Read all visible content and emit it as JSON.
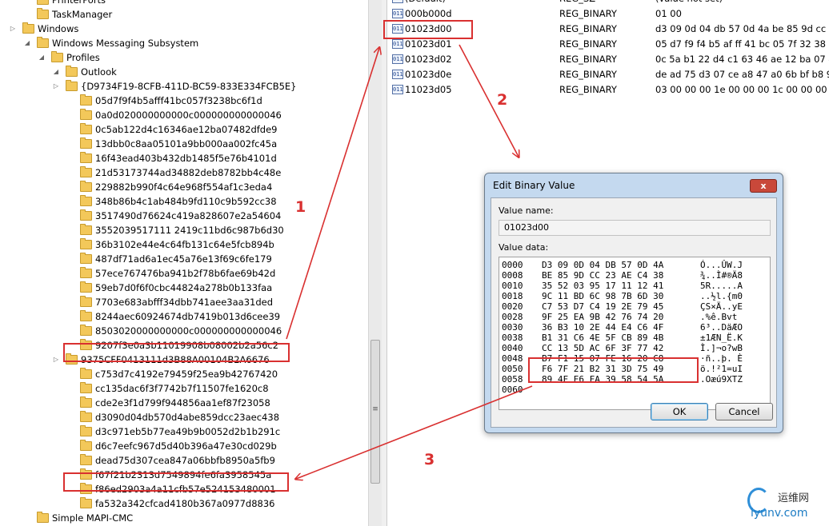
{
  "tree": {
    "items": [
      {
        "label": "PrinterPorts",
        "expander": ""
      },
      {
        "label": "TaskManager",
        "expander": ""
      },
      {
        "label": "Windows",
        "expander": "▷"
      },
      {
        "label": "Windows Messaging Subsystem",
        "expander": "◢"
      },
      {
        "label": "Profiles",
        "expander": "◢"
      },
      {
        "label": "Outlook",
        "expander": "◢"
      },
      {
        "label": "{D9734F19-8CFB-411D-BC59-833E334FCB5E}",
        "expander": "▷"
      },
      {
        "label": "05d7f9f4b5afff41bc057f3238bc6f1d",
        "expander": ""
      },
      {
        "label": "0a0d020000000000c000000000000046",
        "expander": ""
      },
      {
        "label": "0c5ab122d4c16346ae12ba07482dfde9",
        "expander": ""
      },
      {
        "label": "13dbb0c8aa05101a9bb000aa002fc45a",
        "expander": ""
      },
      {
        "label": "16f43ead403b432db1485f5e76b4101d",
        "expander": ""
      },
      {
        "label": "21d53173744ad34882deb8782bb4c48e",
        "expander": ""
      },
      {
        "label": "229882b990f4c64e968f554af1c3eda4",
        "expander": ""
      },
      {
        "label": "348b86b4c1ab484b9fd110c9b592cc38",
        "expander": ""
      },
      {
        "label": "3517490d76624c419a828607e2a54604",
        "expander": ""
      },
      {
        "label": "3552039517111 2419c11bd6c987b6d30",
        "expander": ""
      },
      {
        "label": "36b3102e44e4c64fb131c64e5fcb894b",
        "expander": ""
      },
      {
        "label": "487df71ad6a1ec45a76e13f69c6fe179",
        "expander": ""
      },
      {
        "label": "57ece767476ba941b2f78b6fae69b42d",
        "expander": ""
      },
      {
        "label": "59eb7d0f6f0cbc44824a278b0b133faa",
        "expander": ""
      },
      {
        "label": "7703e683abfff34dbb741aee3aa31ded",
        "expander": ""
      },
      {
        "label": "8244aec60924674db7419b013d6cee39",
        "expander": ""
      },
      {
        "label": "8503020000000000c000000000000046",
        "expander": ""
      },
      {
        "label": "9207f3e0a3b11019908b08002b2a56c2",
        "expander": ""
      },
      {
        "label": "9375CFF0413111d3B88A00104B2A6676",
        "expander": "▷"
      },
      {
        "label": "c753d7c4192e79459f25ea9b42767420",
        "expander": ""
      },
      {
        "label": "cc135dac6f3f7742b7f11507fe1620c8",
        "expander": ""
      },
      {
        "label": "cde2e3f1d799f944856aa1ef87f23058",
        "expander": ""
      },
      {
        "label": "d3090d04db570d4abe859dcc23aec438",
        "expander": ""
      },
      {
        "label": "d3c971eb5b77ea49b9b0052d2b1b291c",
        "expander": ""
      },
      {
        "label": "d6c7eefc967d5d40b396a47e30cd029b",
        "expander": ""
      },
      {
        "label": "dead75d307cea847a06bbfb8950a5fb9",
        "expander": ""
      },
      {
        "label": "f67f21b2313d7549894fe6fa3958545a",
        "expander": ""
      },
      {
        "label": "f86ed2903a4a11cfb57e524153480001",
        "expander": ""
      },
      {
        "label": "fa532a342cfcad4180b367a0977d8836",
        "expander": ""
      },
      {
        "label": "Simple MAPI-CMC",
        "expander": ""
      }
    ]
  },
  "values": {
    "rows": [
      {
        "name": "(Default)",
        "type": "REG_SZ",
        "data": "(value not set)",
        "icon": "ab"
      },
      {
        "name": "000b000d",
        "type": "REG_BINARY",
        "data": "01 00",
        "icon": "011"
      },
      {
        "name": "01023d00",
        "type": "REG_BINARY",
        "data": "d3 09 0d 04 db 57 0d 4a be 85 9d cc 23 ae",
        "icon": "011"
      },
      {
        "name": "01023d01",
        "type": "REG_BINARY",
        "data": "05 d7 f9 f4 b5 af ff 41 bc 05 7f 32 38 bc 6f 1",
        "icon": "011"
      },
      {
        "name": "01023d02",
        "type": "REG_BINARY",
        "data": "0c 5a b1 22 d4 c1 63 46 ae 12 ba 07 48 2d f",
        "icon": "011"
      },
      {
        "name": "01023d0e",
        "type": "REG_BINARY",
        "data": "de ad 75 d3 07 ce a8 47 a0 6b bf b8 95 0a 5",
        "icon": "011"
      },
      {
        "name": "11023d05",
        "type": "REG_BINARY",
        "data": "03 00 00 00 1e 00 00 00 1c 00 00 00 5a 00 00",
        "icon": "011"
      }
    ]
  },
  "dialog": {
    "title": "Edit Binary Value",
    "close_label": "x",
    "value_name_label": "Value name:",
    "value_name": "01023d00",
    "value_data_label": "Value data:",
    "hex_lines": [
      {
        "offset": "0000",
        "bytes": "D3 09 0D 04 DB 57 0D 4A",
        "ascii": "Ó...ÛW.J"
      },
      {
        "offset": "0008",
        "bytes": "BE 85 9D CC 23 AE C4 38",
        "ascii": "¾..Ì#®Ä8"
      },
      {
        "offset": "0010",
        "bytes": "35 52 03 95 17 11 12 41",
        "ascii": "5R.....A"
      },
      {
        "offset": "0018",
        "bytes": "9C 11 BD 6C 98 7B 6D 30",
        "ascii": "..½l.{m0"
      },
      {
        "offset": "0020",
        "bytes": "C7 53 D7 C4 19 2E 79 45",
        "ascii": "ÇS×Ä..yE"
      },
      {
        "offset": "0028",
        "bytes": "9F 25 EA 9B 42 76 74 20",
        "ascii": ".%ê.Bvt "
      },
      {
        "offset": "0030",
        "bytes": "36 B3 10 2E 44 E4 C6 4F",
        "ascii": "6³..DäÆO"
      },
      {
        "offset": "0038",
        "bytes": "B1 31 C6 4E 5F CB 89 4B",
        "ascii": "±1ÆN_Ë.K"
      },
      {
        "offset": "0040",
        "bytes": "CC 13 5D AC 6F 3F 77 42",
        "ascii": "Ì.]¬o?wB"
      },
      {
        "offset": "0048",
        "bytes": "B7 F1 15 07 FE 16 20 C8",
        "ascii": "·ñ..þ. È"
      },
      {
        "offset": "0050",
        "bytes": "F6 7F 21 B2 31 3D 75 49",
        "ascii": "ö.!²1=uI"
      },
      {
        "offset": "0058",
        "bytes": "89 4F E6 FA 39 58 54 5A",
        "ascii": ".Oæú9XTZ"
      },
      {
        "offset": "0060",
        "bytes": "",
        "ascii": ""
      }
    ],
    "ok_label": "OK",
    "cancel_label": "Cancel"
  },
  "annotations": {
    "step1": "1",
    "step2": "2",
    "step3": "3",
    "color": "#d93030"
  },
  "watermark": {
    "cn": "运维网",
    "en": "iyunv.com"
  }
}
